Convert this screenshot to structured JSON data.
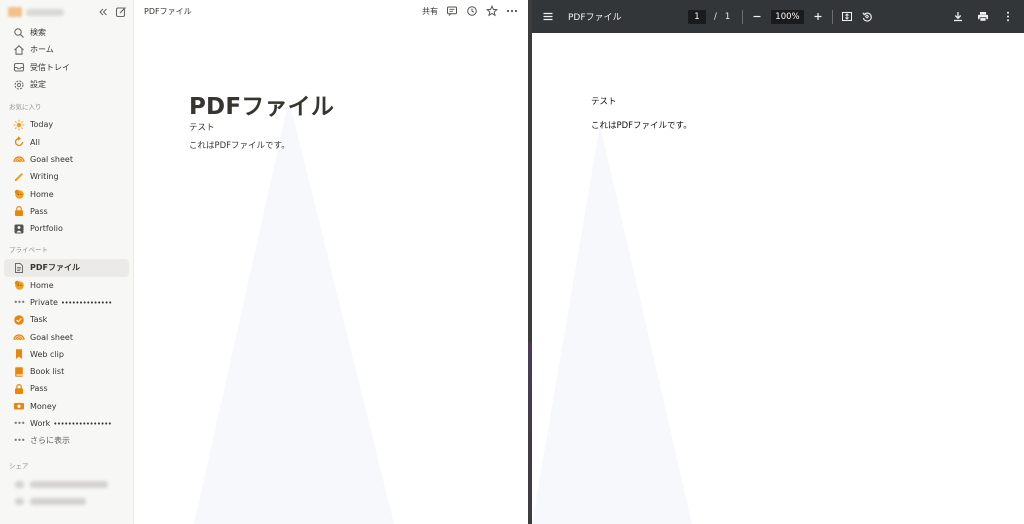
{
  "sidebar": {
    "nav": [
      {
        "label": "検索",
        "icon": "search-icon"
      },
      {
        "label": "ホーム",
        "icon": "home-icon"
      },
      {
        "label": "受信トレイ",
        "icon": "inbox-icon"
      },
      {
        "label": "設定",
        "icon": "settings-gear-icon"
      }
    ],
    "favorites_heading": "お気に入り",
    "favorites": [
      {
        "label": "Today",
        "icon": "sun-icon"
      },
      {
        "label": "All",
        "icon": "refresh-icon"
      },
      {
        "label": "Goal sheet",
        "icon": "rainbow-icon"
      },
      {
        "label": "Writing",
        "icon": "pencil-icon"
      },
      {
        "label": "Home",
        "icon": "emoji-face-icon"
      },
      {
        "label": "Pass",
        "icon": "lock-icon"
      },
      {
        "label": "Portfolio",
        "icon": "portfolio-icon"
      }
    ],
    "private_heading": "プライベート",
    "private": [
      {
        "label": "PDFファイル",
        "icon": "document-icon"
      },
      {
        "label": "Home",
        "icon": "emoji-face-icon"
      },
      {
        "label": "Private",
        "masked": "••••••••••••••",
        "icon": "more-dots-icon"
      },
      {
        "label": "Task",
        "icon": "check-circle-icon"
      },
      {
        "label": "Goal sheet",
        "icon": "rainbow-icon"
      },
      {
        "label": "Web clip",
        "icon": "bookmark-icon"
      },
      {
        "label": "Book list",
        "icon": "book-icon"
      },
      {
        "label": "Pass",
        "icon": "lock-icon"
      },
      {
        "label": "Money",
        "icon": "money-icon"
      },
      {
        "label": "Work",
        "masked": "••••••••••••••••",
        "icon": "more-dots-icon"
      },
      {
        "label": "さらに表示",
        "icon": "more-dots-icon"
      }
    ],
    "share_heading": "シェア"
  },
  "main": {
    "breadcrumb": "PDFファイル",
    "share_label": "共有",
    "title": "PDFファイル",
    "lines": [
      "テスト",
      "これはPDFファイルです。"
    ]
  },
  "viewer": {
    "title": "PDFファイル",
    "current_page": "1",
    "page_separator": "/",
    "total_pages": "1",
    "zoom": "100%",
    "lines": [
      "テスト",
      "これはPDFファイルです。"
    ]
  },
  "colors": {
    "sidebar_bg": "#f7f7f5",
    "accent_orange": "#e8850c",
    "viewer_toolbar": "#323639",
    "text": "#37352f"
  }
}
